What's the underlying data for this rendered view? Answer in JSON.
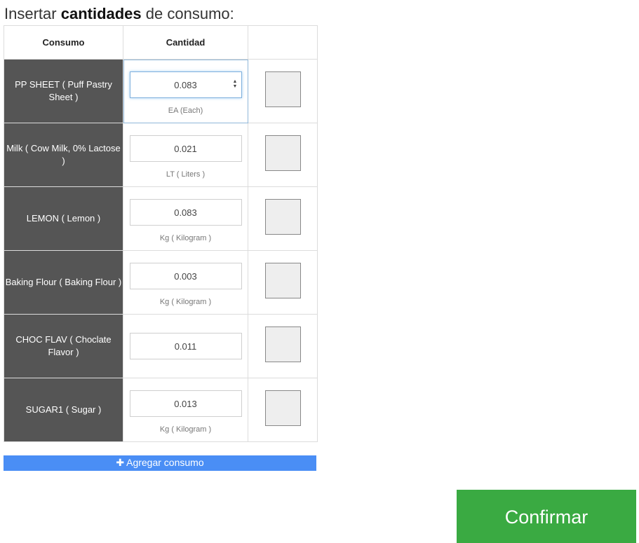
{
  "title": {
    "prefix": "Insertar",
    "bold": "cantidades",
    "suffix": "de consumo:"
  },
  "table": {
    "headers": [
      "Consumo",
      "Cantidad",
      ""
    ],
    "rows": [
      {
        "name": "PP SHEET ( Puff Pastry Sheet )",
        "quantity": "0.083",
        "unit": "EA (Each)"
      },
      {
        "name": "Milk ( Cow Milk, 0% Lactose )",
        "quantity": "0.021",
        "unit": "LT ( Liters )"
      },
      {
        "name": "LEMON ( Lemon )",
        "quantity": "0.083",
        "unit": "Kg ( Kilogram )"
      },
      {
        "name": "Baking Flour ( Baking Flour )",
        "quantity": "0.003",
        "unit": "Kg ( Kilogram )"
      },
      {
        "name": "CHOC FLAV ( Choclate Flavor )",
        "quantity": "0.011",
        "unit": ""
      },
      {
        "name": "SUGAR1 ( Sugar )",
        "quantity": "0.013",
        "unit": "Kg ( Kilogram )"
      }
    ]
  },
  "add_button": {
    "icon": "plus-icon",
    "label": "Agregar consumo"
  },
  "confirm_button": {
    "label": "Confirmar"
  },
  "colors": {
    "name_cell_bg": "#555555",
    "add_button_bg": "#4a8ef5",
    "confirm_button_bg": "#3aaa42"
  }
}
